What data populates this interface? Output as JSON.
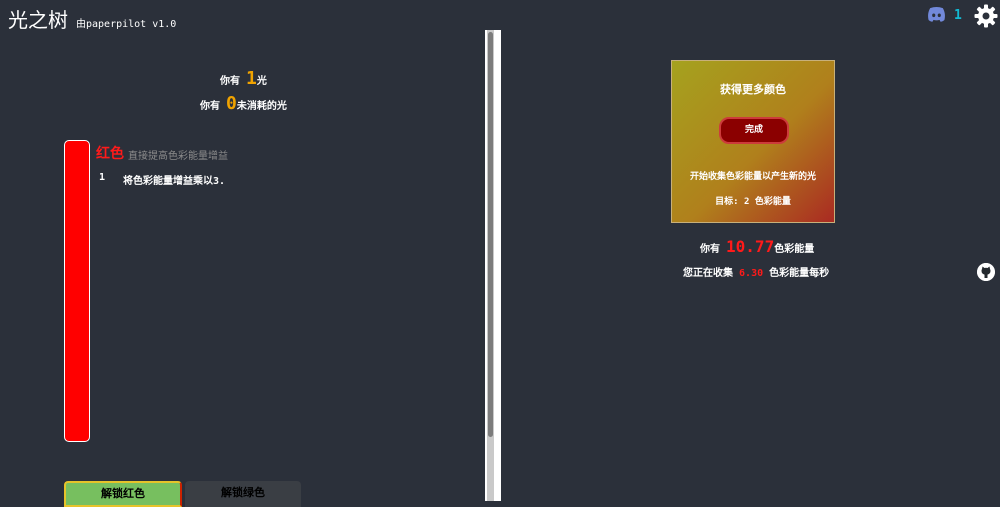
{
  "header": {
    "title": "光之树",
    "subtitle": "由paperpilot v1.0",
    "discord_count": "1",
    "icons": [
      "discord-icon",
      "gear-icon",
      "github-icon"
    ]
  },
  "left": {
    "light_prefix": "你有",
    "light_value": "1",
    "light_suffix": "光",
    "unspent_prefix": "你有",
    "unspent_value": "0",
    "unspent_suffix": "未消耗的光",
    "upgrade": {
      "title": "红色",
      "description": "直接提高色彩能量增益",
      "level": "1",
      "effect": "将色彩能量增益乘以3."
    },
    "tabs": {
      "unlock_red": "解锁红色",
      "unlock_green": "解锁绿色"
    }
  },
  "right": {
    "challenge": {
      "title": "获得更多颜色",
      "button": "完成",
      "description": "开始收集色彩能量以产生新的光",
      "goal": "目标: 2 色彩能量"
    },
    "energy_prefix": "你有",
    "energy_value": "10.77",
    "energy_suffix": "色彩能量",
    "rate_prefix": "您正在收集",
    "rate_value": "6.30",
    "rate_suffix": "色彩能量每秒"
  },
  "colors": {
    "background": "#2b303a",
    "accent_orange": "#f0a300",
    "accent_red": "#ff0000",
    "discord_cyan": "#12b9d2",
    "unlock_green": "#77bf5f"
  }
}
